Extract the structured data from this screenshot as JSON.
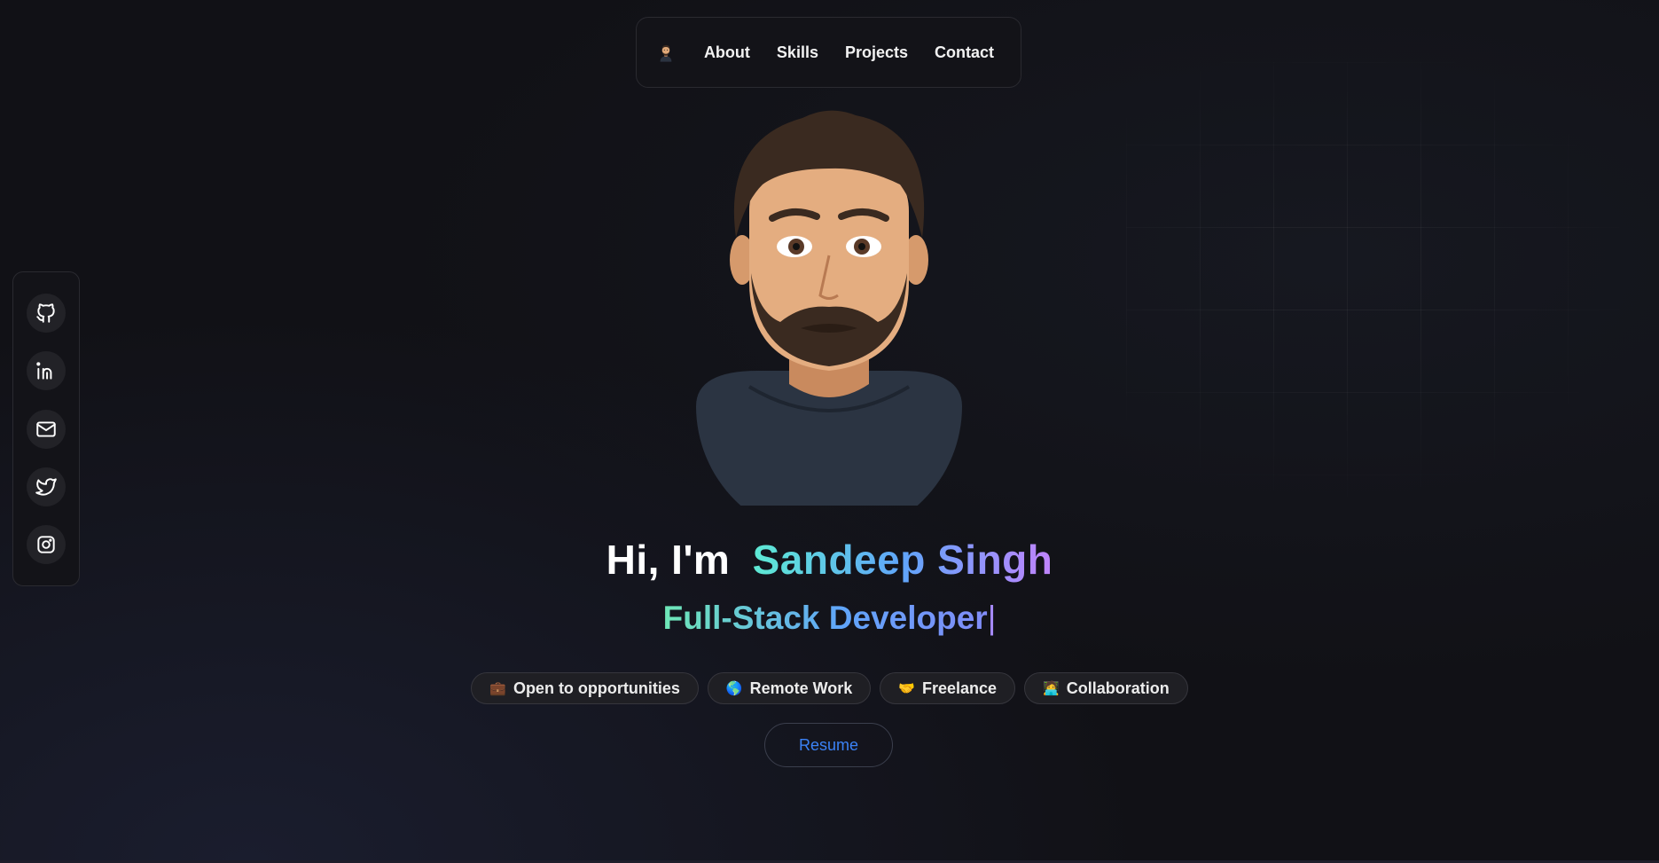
{
  "nav": {
    "links": [
      "About",
      "Skills",
      "Projects",
      "Contact"
    ]
  },
  "social": {
    "icons": [
      "github-icon",
      "linkedin-icon",
      "mail-icon",
      "twitter-icon",
      "instagram-icon"
    ]
  },
  "hero": {
    "greeting": "Hi, I'm",
    "name": "Sandeep Singh",
    "role": "Full-Stack Developer",
    "cursor": "|",
    "badges": [
      {
        "emoji": "💼",
        "label": "Open to opportunities"
      },
      {
        "emoji": "🌎",
        "label": "Remote Work"
      },
      {
        "emoji": "🤝",
        "label": "Freelance"
      },
      {
        "emoji": "🧑‍💻",
        "label": "Collaboration"
      }
    ],
    "resume_label": "Resume"
  },
  "colors": {
    "accent": "#3b82f6",
    "gradient_start": "#5eead4",
    "gradient_end": "#c084fc",
    "background": "#111116"
  }
}
